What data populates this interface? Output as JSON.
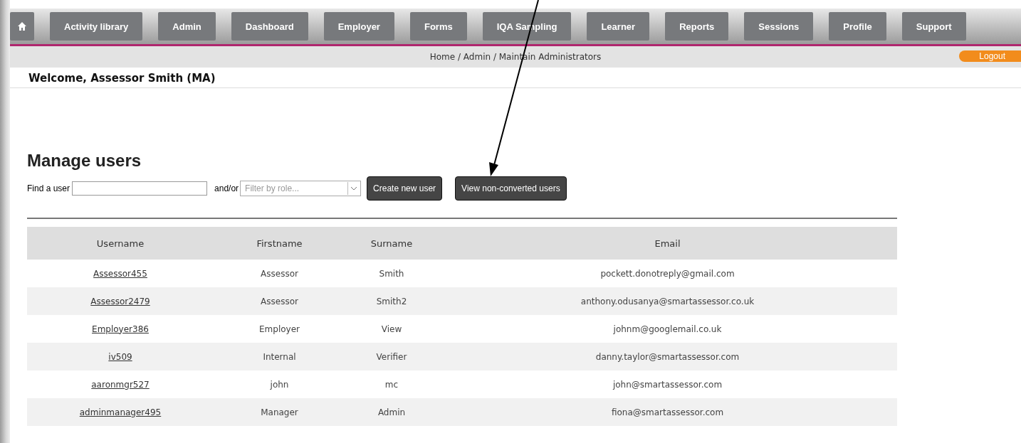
{
  "nav": {
    "items": [
      {
        "kind": "home"
      },
      {
        "kind": "text",
        "label": "Activity library"
      },
      {
        "kind": "text",
        "label": "Admin"
      },
      {
        "kind": "text",
        "label": "Dashboard"
      },
      {
        "kind": "text",
        "label": "Employer"
      },
      {
        "kind": "text",
        "label": "Forms"
      },
      {
        "kind": "text",
        "label": "IQA Sampling"
      },
      {
        "kind": "text",
        "label": "Learner"
      },
      {
        "kind": "text",
        "label": "Reports"
      },
      {
        "kind": "text",
        "label": "Sessions"
      },
      {
        "kind": "text",
        "label": "Profile"
      },
      {
        "kind": "text",
        "label": "Support"
      }
    ]
  },
  "breadcrumb": "Home / Admin / Maintain Administrators",
  "logout": "Logout",
  "welcome": "Welcome, Assessor Smith (MA)",
  "heading": "Manage users",
  "search": {
    "label": "Find a user",
    "joiner": "and/or",
    "role_filter": {
      "placeholder": "Filter by role..."
    }
  },
  "buttons": [
    "Create new user",
    "View non-converted users"
  ],
  "table": {
    "columns": [
      "Username",
      "Firstname",
      "Surname",
      "Email"
    ],
    "rows": [
      [
        "Assessor455",
        "Assessor",
        "Smith",
        "pockett.donotreply@gmail.com"
      ],
      [
        "Assessor2479",
        "Assessor",
        "Smith2",
        "anthony.odusanya@smartassessor.co.uk"
      ],
      [
        "Employer386",
        "Employer",
        "View",
        "johnm@googlemail.co.uk"
      ],
      [
        "iv509",
        "Internal",
        "Verifier",
        "danny.taylor@smartassessor.com"
      ],
      [
        "aaronmgr527",
        "john",
        "mc",
        "john@smartassessor.com"
      ],
      [
        "adminmanager495",
        "Manager",
        "Admin",
        "fiona@smartassessor.com"
      ]
    ]
  }
}
